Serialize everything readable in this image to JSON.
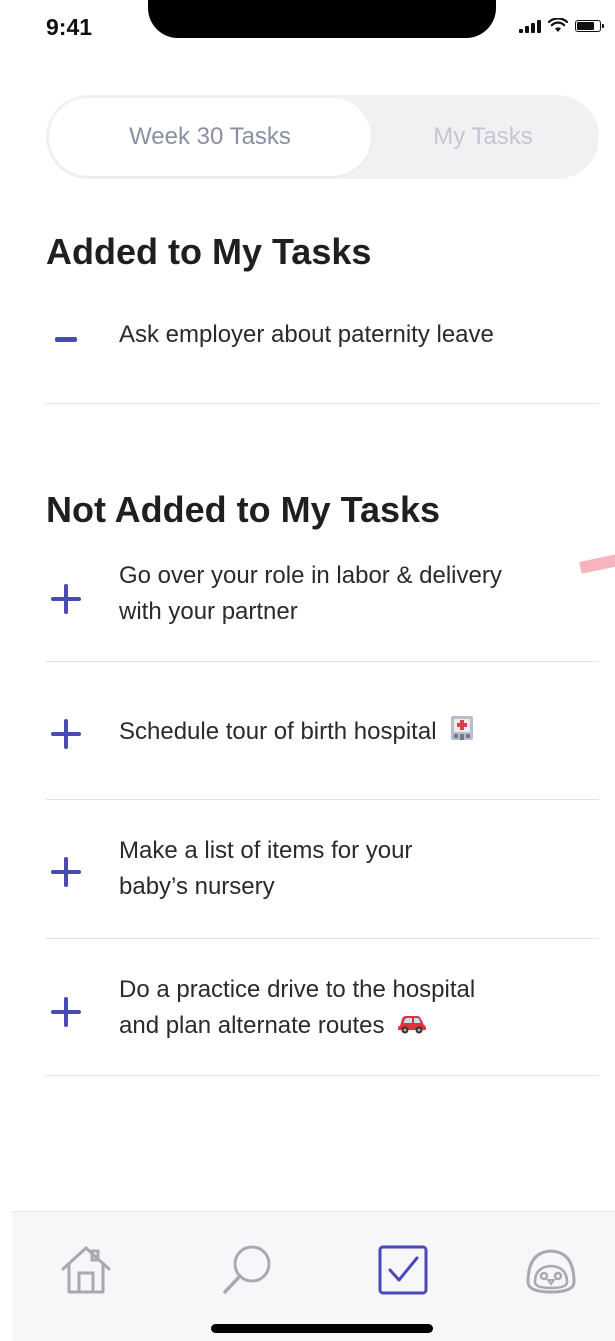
{
  "status_bar": {
    "time": "9:41",
    "battery_level": 0.8
  },
  "segmented_control": {
    "tabs": [
      {
        "label": "Week 30 Tasks",
        "selected": true
      },
      {
        "label": "My Tasks",
        "selected": false
      }
    ]
  },
  "added_section": {
    "title": "Added to My Tasks",
    "items": [
      {
        "text": "Ask employer about paternity leave",
        "action": "remove"
      }
    ]
  },
  "not_added_section": {
    "title": "Not Added to My Tasks",
    "items": [
      {
        "line1": "Go over your role in labor & delivery",
        "line2": "with your partner",
        "action": "add"
      },
      {
        "line1": "Schedule tour of birth hospital",
        "emoji": "hospital-icon",
        "action": "add"
      },
      {
        "line1": "Make a list of items for your",
        "line2": "baby’s nursery",
        "action": "add"
      },
      {
        "line1": "Do a practice drive to the hospital",
        "line2": "and plan alternate routes",
        "emoji": "car-icon",
        "action": "add"
      }
    ]
  },
  "tab_bar": {
    "items": [
      {
        "name": "home",
        "icon": "home-icon",
        "active": false
      },
      {
        "name": "search",
        "icon": "search-icon",
        "active": false
      },
      {
        "name": "tasks",
        "icon": "checkbox-icon",
        "active": true
      },
      {
        "name": "profile",
        "icon": "penguin-icon",
        "active": false
      }
    ]
  },
  "colors": {
    "accent": "#4a4ab5",
    "inactive_icon": "#a9a9b0",
    "title_text": "#1f1f1f",
    "body_text": "#2a2a2a",
    "divider": "#e1e1e6"
  }
}
